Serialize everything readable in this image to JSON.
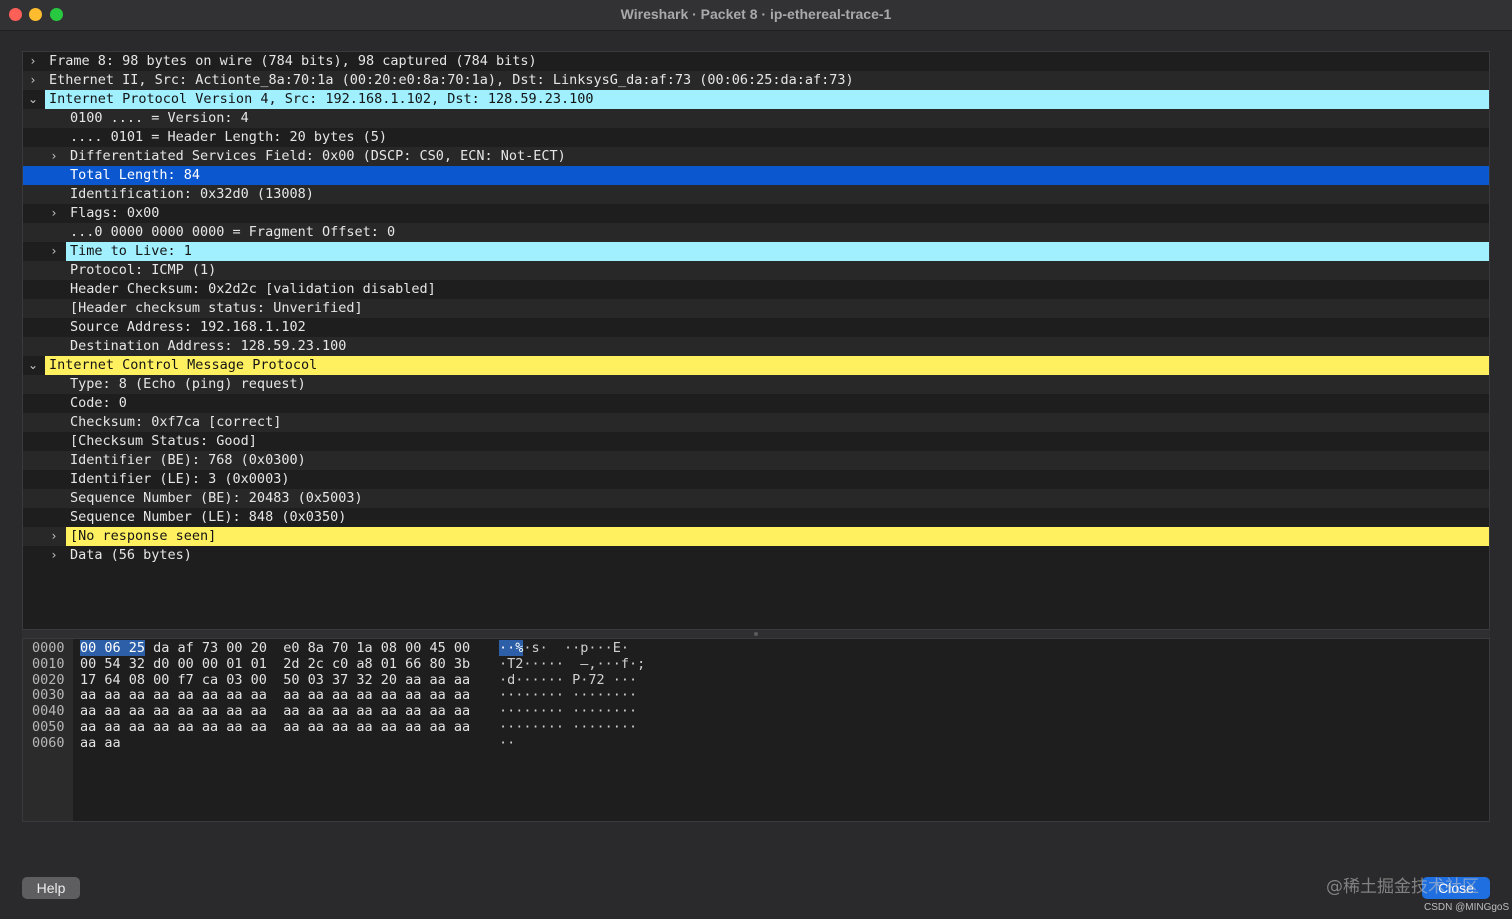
{
  "window": {
    "title": "Wireshark · Packet 8 · ip-ethereal-trace-1"
  },
  "icons": {
    "collapsed": "chevron-right-icon",
    "expanded": "chevron-down-icon"
  },
  "colors": {
    "selected": "#0b57d0",
    "ip_highlight": "#a0f0ff",
    "icmp_highlight": "#fff060",
    "close_button": "#1f6fe0"
  },
  "tree": [
    {
      "text": "Frame 8: 98 bytes on wire (784 bits), 98 captured (784 bits)",
      "level": 0,
      "toggle": "collapsed",
      "hl": "none"
    },
    {
      "text": "Ethernet II, Src: Actionte_8a:70:1a (00:20:e0:8a:70:1a), Dst: LinksysG_da:af:73 (00:06:25:da:af:73)",
      "level": 0,
      "toggle": "collapsed",
      "hl": "none"
    },
    {
      "text": "Internet Protocol Version 4, Src: 192.168.1.102, Dst: 128.59.23.100",
      "level": 0,
      "toggle": "expanded",
      "hl": "cyan"
    },
    {
      "text": "0100 .... = Version: 4",
      "level": 1,
      "toggle": "none",
      "hl": "none"
    },
    {
      "text": ".... 0101 = Header Length: 20 bytes (5)",
      "level": 1,
      "toggle": "none",
      "hl": "none"
    },
    {
      "text": "Differentiated Services Field: 0x00 (DSCP: CS0, ECN: Not-ECT)",
      "level": 1,
      "toggle": "collapsed",
      "hl": "none"
    },
    {
      "text": "Total Length: 84",
      "level": 1,
      "toggle": "none",
      "hl": "selected"
    },
    {
      "text": "Identification: 0x32d0 (13008)",
      "level": 1,
      "toggle": "none",
      "hl": "none"
    },
    {
      "text": "Flags: 0x00",
      "level": 1,
      "toggle": "collapsed",
      "hl": "none"
    },
    {
      "text": "...0 0000 0000 0000 = Fragment Offset: 0",
      "level": 1,
      "toggle": "none",
      "hl": "none"
    },
    {
      "text": "Time to Live: 1",
      "level": 1,
      "toggle": "collapsed",
      "hl": "cyan"
    },
    {
      "text": "Protocol: ICMP (1)",
      "level": 1,
      "toggle": "none",
      "hl": "none"
    },
    {
      "text": "Header Checksum: 0x2d2c [validation disabled]",
      "level": 1,
      "toggle": "none",
      "hl": "none"
    },
    {
      "text": "[Header checksum status: Unverified]",
      "level": 1,
      "toggle": "none",
      "hl": "none"
    },
    {
      "text": "Source Address: 192.168.1.102",
      "level": 1,
      "toggle": "none",
      "hl": "none"
    },
    {
      "text": "Destination Address: 128.59.23.100",
      "level": 1,
      "toggle": "none",
      "hl": "none"
    },
    {
      "text": "Internet Control Message Protocol",
      "level": 0,
      "toggle": "expanded",
      "hl": "yellow"
    },
    {
      "text": "Type: 8 (Echo (ping) request)",
      "level": 1,
      "toggle": "none",
      "hl": "none"
    },
    {
      "text": "Code: 0",
      "level": 1,
      "toggle": "none",
      "hl": "none"
    },
    {
      "text": "Checksum: 0xf7ca [correct]",
      "level": 1,
      "toggle": "none",
      "hl": "none"
    },
    {
      "text": "[Checksum Status: Good]",
      "level": 1,
      "toggle": "none",
      "hl": "none"
    },
    {
      "text": "Identifier (BE): 768 (0x0300)",
      "level": 1,
      "toggle": "none",
      "hl": "none"
    },
    {
      "text": "Identifier (LE): 3 (0x0003)",
      "level": 1,
      "toggle": "none",
      "hl": "none"
    },
    {
      "text": "Sequence Number (BE): 20483 (0x5003)",
      "level": 1,
      "toggle": "none",
      "hl": "none"
    },
    {
      "text": "Sequence Number (LE): 848 (0x0350)",
      "level": 1,
      "toggle": "none",
      "hl": "none"
    },
    {
      "text": "[No response seen]",
      "level": 1,
      "toggle": "collapsed",
      "hl": "yellow"
    },
    {
      "text": "Data (56 bytes)",
      "level": 1,
      "toggle": "collapsed",
      "hl": "none"
    }
  ],
  "hex": [
    {
      "offset": "0000",
      "sel_bytes": "00 06 25",
      "bytes": " da af 73 00 20  e0 8a 70 1a 08 00 45 00",
      "sel_ascii": "··%",
      "ascii": "·s·  ··p···E·"
    },
    {
      "offset": "0010",
      "sel_bytes": "",
      "bytes": "00 54 32 d0 00 00 01 01  2d 2c c0 a8 01 66 80 3b",
      "sel_ascii": "",
      "ascii": "·T2·····  –,···f·;"
    },
    {
      "offset": "0020",
      "sel_bytes": "",
      "bytes": "17 64 08 00 f7 ca 03 00  50 03 37 32 20 aa aa aa",
      "sel_ascii": "",
      "ascii": "·d······ P·72 ···"
    },
    {
      "offset": "0030",
      "sel_bytes": "",
      "bytes": "aa aa aa aa aa aa aa aa  aa aa aa aa aa aa aa aa",
      "sel_ascii": "",
      "ascii": "········ ········"
    },
    {
      "offset": "0040",
      "sel_bytes": "",
      "bytes": "aa aa aa aa aa aa aa aa  aa aa aa aa aa aa aa aa",
      "sel_ascii": "",
      "ascii": "········ ········"
    },
    {
      "offset": "0050",
      "sel_bytes": "",
      "bytes": "aa aa aa aa aa aa aa aa  aa aa aa aa aa aa aa aa",
      "sel_ascii": "",
      "ascii": "········ ········"
    },
    {
      "offset": "0060",
      "sel_bytes": "",
      "bytes": "aa aa",
      "sel_ascii": "",
      "ascii": "··"
    }
  ],
  "buttons": {
    "help": "Help",
    "close": "Close"
  },
  "watermark": {
    "site": "@稀土掘金技术社区",
    "author": "CSDN @MINGgoS"
  }
}
